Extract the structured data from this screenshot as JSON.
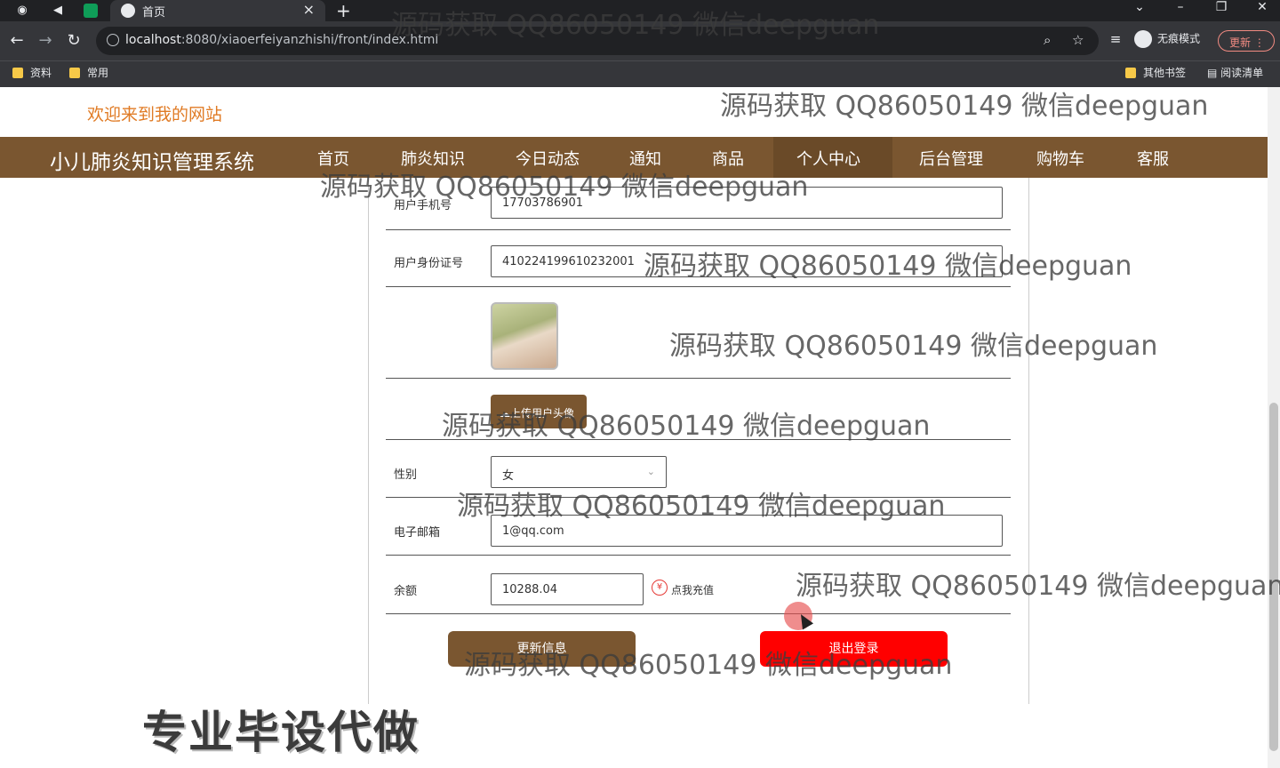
{
  "browser": {
    "tab_title": "首页",
    "new_tab": "+",
    "url_host": "localhost",
    "url_rest": ":8080/xiaoerfeiyanzhishi/front/index.html",
    "incognito_label": "无痕模式",
    "update_label": "更新",
    "bookmarks": [
      "资料",
      "常用"
    ],
    "bookmarks_right": [
      "其他书签",
      "阅读清单"
    ]
  },
  "site": {
    "welcome": "欢迎来到我的网站",
    "brand": "小儿肺炎知识管理系统",
    "nav": [
      "首页",
      "肺炎知识",
      "今日动态",
      "通知",
      "商品",
      "个人中心",
      "后台管理",
      "购物车",
      "客服"
    ],
    "active_nav": "个人中心"
  },
  "form": {
    "phone_label": "用户手机号",
    "phone_value": "17703786901",
    "idcard_label": "用户身份证号",
    "idcard_value": "410224199610232001",
    "upload_label": "上传用户头像",
    "gender_label": "性别",
    "gender_value": "女",
    "email_label": "电子邮箱",
    "email_value": "1@qq.com",
    "balance_label": "余额",
    "balance_value": "10288.04",
    "recharge_label": "点我充值",
    "update_button": "更新信息",
    "logout_button": "退出登录"
  },
  "overlay": {
    "watermark": "源码获取 QQ86050149 微信deepguan",
    "ad_text": "专业毕设代做"
  }
}
